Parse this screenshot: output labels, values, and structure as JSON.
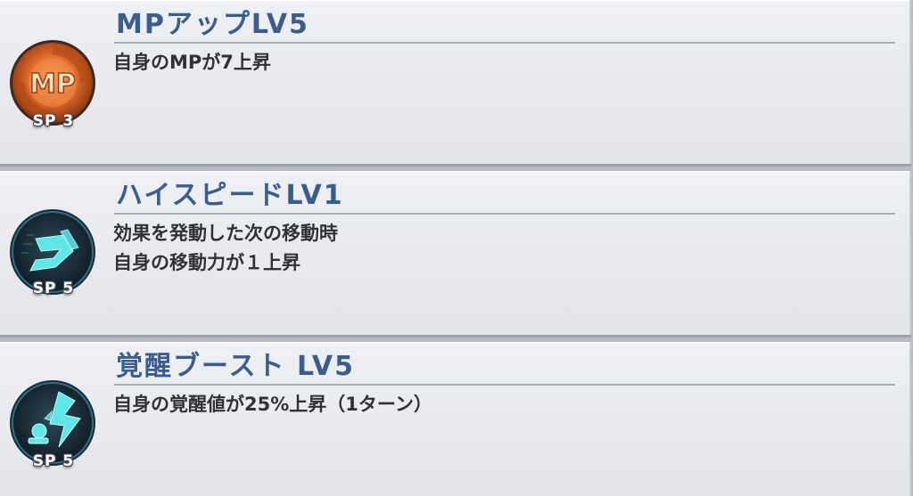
{
  "skills": [
    {
      "title": "MPアップLV5",
      "description": "自身のMPが7上昇",
      "sp_cost": "SP 3",
      "icon": "mp-up-icon",
      "icon_color": "#e0692a"
    },
    {
      "title": "ハイスピードLV1",
      "description": "効果を発動した次の移動時\n自身の移動力が１上昇",
      "sp_cost": "SP 5",
      "icon": "high-speed-boot-icon",
      "icon_color": "#5fe6e6"
    },
    {
      "title": "覚醒ブースト LV5",
      "description": "自身の覚醒値が25%上昇（1ターン）",
      "sp_cost": "SP 5",
      "icon": "awakening-boost-icon",
      "icon_color": "#5fe6e6"
    }
  ],
  "colors": {
    "title": "#3a5d8f",
    "description": "#303238",
    "panel": "#e9ebef",
    "background": "#b9bdc4"
  }
}
